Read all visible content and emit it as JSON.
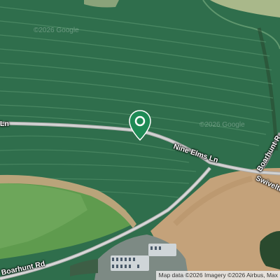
{
  "map": {
    "type": "satellite",
    "marker": {
      "icon": "location-pin-icon",
      "color": "#1e8a55"
    },
    "roads": {
      "nine_elms_lower": "Nine Elms Ln",
      "nine_elms_left": "Ln",
      "boarhunt_rd_bottom": "Boarhunt Rd",
      "swivelton": "Swivelto",
      "boarhunt_right": "Boarhunt R"
    },
    "watermarks": [
      "©2026 Google",
      "©2026 Google"
    ],
    "attribution": "Map data ©2026 Imagery ©2026 Airbus, Max"
  }
}
